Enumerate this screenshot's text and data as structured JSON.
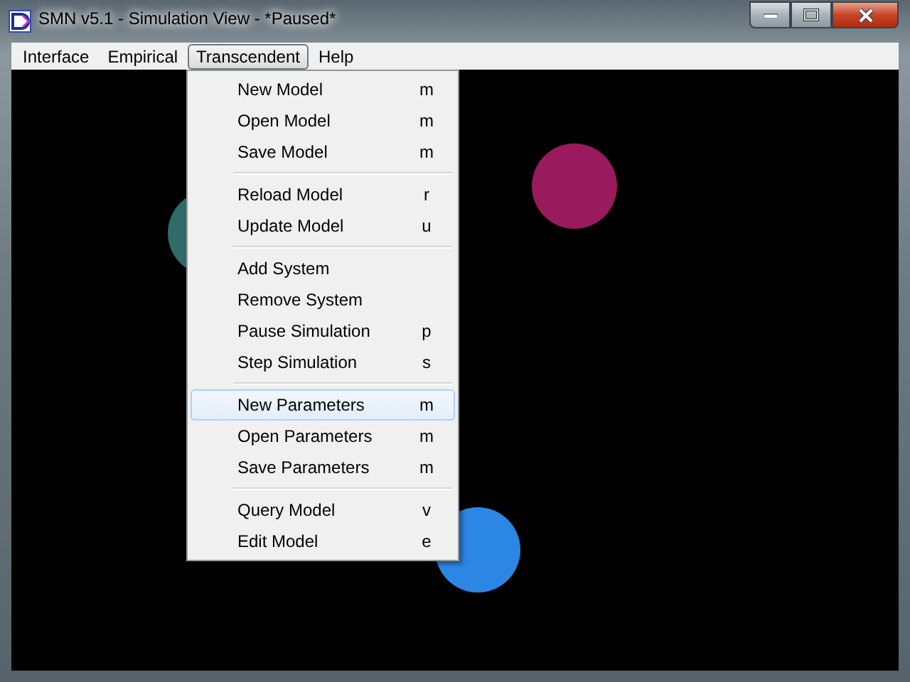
{
  "window": {
    "title": "SMN v5.1 - Simulation View - *Paused*"
  },
  "menubar": [
    {
      "label": "Interface",
      "selected": false
    },
    {
      "label": "Empirical",
      "selected": false
    },
    {
      "label": "Transcendent",
      "selected": true
    },
    {
      "label": "Help",
      "selected": false
    }
  ],
  "dropdown": {
    "groups": [
      [
        {
          "label": "New Model",
          "shortcut": "m",
          "selected": false
        },
        {
          "label": "Open Model",
          "shortcut": "m",
          "selected": false
        },
        {
          "label": "Save Model",
          "shortcut": "m",
          "selected": false
        }
      ],
      [
        {
          "label": "Reload Model",
          "shortcut": "r",
          "selected": false
        },
        {
          "label": "Update Model",
          "shortcut": "u",
          "selected": false
        }
      ],
      [
        {
          "label": "Add System",
          "selected": false
        },
        {
          "label": "Remove System",
          "selected": false
        },
        {
          "label": "Pause Simulation",
          "shortcut": "p",
          "selected": false
        },
        {
          "label": "Step Simulation",
          "shortcut": "s",
          "selected": false
        }
      ],
      [
        {
          "label": "New Parameters",
          "shortcut": "m",
          "selected": true
        },
        {
          "label": "Open Parameters",
          "shortcut": "m",
          "selected": false
        },
        {
          "label": "Save Parameters",
          "shortcut": "m",
          "selected": false
        }
      ],
      [
        {
          "label": "Query Model",
          "shortcut": "v",
          "selected": false
        },
        {
          "label": "Edit Model",
          "shortcut": "e",
          "selected": false
        }
      ]
    ]
  },
  "circles": [
    {
      "color": "#2f6b68"
    },
    {
      "color": "#9a1a5e"
    },
    {
      "color": "#2b86e4"
    }
  ]
}
